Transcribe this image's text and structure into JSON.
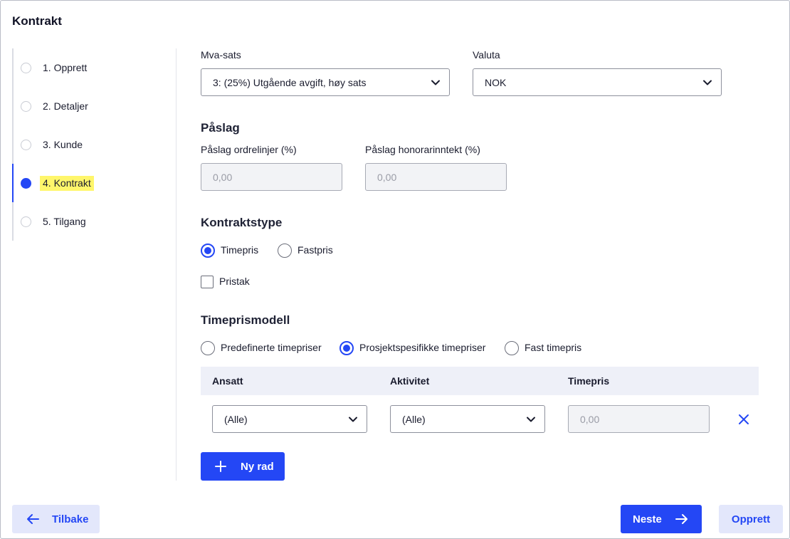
{
  "page": {
    "title": "Kontrakt"
  },
  "steps": [
    {
      "label": "1. Opprett",
      "active": false
    },
    {
      "label": "2. Detaljer",
      "active": false
    },
    {
      "label": "3. Kunde",
      "active": false
    },
    {
      "label": "4. Kontrakt",
      "active": true
    },
    {
      "label": "5. Tilgang",
      "active": false
    }
  ],
  "fields": {
    "mva": {
      "label": "Mva-sats",
      "value": "3: (25%) Utgående avgift, høy sats"
    },
    "valuta": {
      "label": "Valuta",
      "value": "NOK"
    }
  },
  "paaslag": {
    "heading": "Påslag",
    "ordrelinjer": {
      "label": "Påslag ordrelinjer (%)",
      "placeholder": "0,00"
    },
    "honorar": {
      "label": "Påslag honorarinntekt (%)",
      "placeholder": "0,00"
    }
  },
  "kontraktstype": {
    "heading": "Kontraktstype",
    "options": [
      {
        "label": "Timepris",
        "selected": true
      },
      {
        "label": "Fastpris",
        "selected": false
      }
    ],
    "pristak": {
      "label": "Pristak",
      "checked": false
    }
  },
  "timeprismodell": {
    "heading": "Timeprismodell",
    "options": [
      {
        "label": "Predefinerte timepriser",
        "selected": false
      },
      {
        "label": "Prosjektspesifikke timepriser",
        "selected": true
      },
      {
        "label": "Fast timepris",
        "selected": false
      }
    ]
  },
  "table": {
    "columns": [
      "Ansatt",
      "Aktivitet",
      "Timepris"
    ],
    "rows": [
      {
        "ansatt": "(Alle)",
        "aktivitet": "(Alle)",
        "timepris_placeholder": "0,00"
      }
    ],
    "add_row_label": "Ny rad"
  },
  "footer": {
    "back_label": "Tilbake",
    "next_label": "Neste",
    "create_label": "Opprett"
  },
  "colors": {
    "accent": "#2447f5",
    "highlight": "#fff66b",
    "table_header_bg": "#eef0f8"
  }
}
